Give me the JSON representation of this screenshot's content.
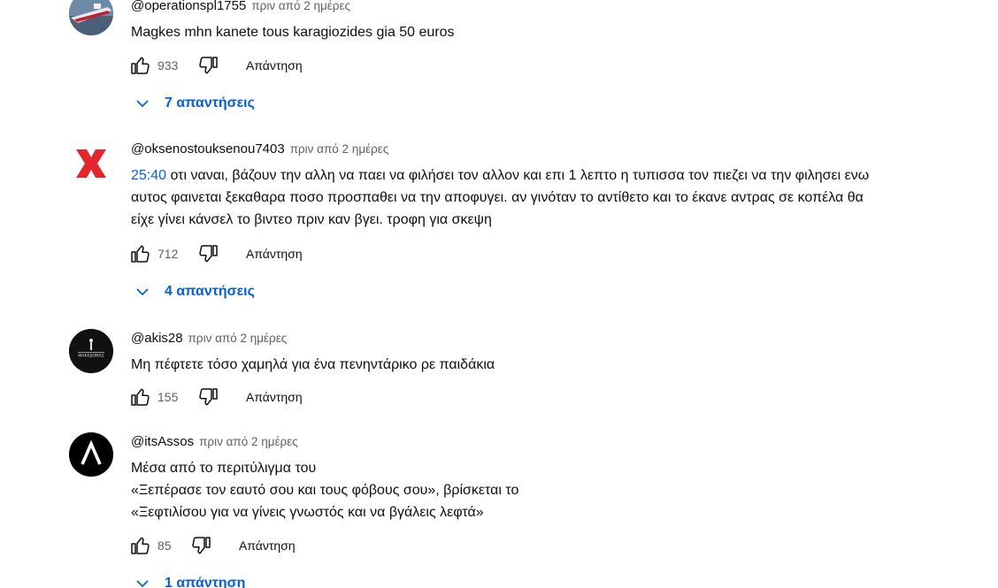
{
  "comments": [
    {
      "author": "@operationspl1755",
      "time": "πριν από 2 ημέρες",
      "timestamp_link": "",
      "lines": [
        "Magkes mhn kanete tous karagiozides gia 50 euros"
      ],
      "likes": "933",
      "reply_label": "Απάντηση",
      "replies_label": "7 απαντήσεις",
      "avatar": "ship-icon"
    },
    {
      "author": "@oksenostouksenou7403",
      "time": "πριν από 2 ημέρες",
      "timestamp_link": "25:40",
      "lines": [
        " οτι ναναι, βάζουν την αλλη να παει να φιλήσει τον αλλον και επι 1 λεπτο η τυπισσα τον πιεζει να την φιλησει ενω",
        "αυτος φαινεται ξεκαθαρα ποσο προσπαθει να την αποφυγει. αν γινόταν το αντίθετο και το έκανε αντρας σε κοπέλα θα",
        "είχε γίνει κάνσελ το βιντεο πριν καν βγει. τροφη για σκεψη"
      ],
      "likes": "712",
      "reply_label": "Απάντηση",
      "replies_label": "4 απαντήσεις",
      "avatar": "red-x-icon"
    },
    {
      "author": "@akis28",
      "time": "πριν από 2 ημέρες",
      "timestamp_link": "",
      "lines": [
        "Μη πέφτετε τόσο χαμηλά για ένα πενηντάρικο ρε παιδάκια"
      ],
      "likes": "155",
      "reply_label": "Απάντηση",
      "replies_label": "",
      "avatar": "makedonas-logo",
      "avatar_text": "ΜΑΚΕΔΟΝΑΣ"
    },
    {
      "author": "@itsAssos",
      "time": "πριν από 2 ημέρες",
      "timestamp_link": "",
      "lines": [
        "Μέσα από το περιτύλιγμα του",
        "«Ξεπέρασε τον εαυτό σου και τους φόβους σου», βρίσκεται το",
        "«Ξεφτιλίσου για να γίνεις γνωστός και να βγάλεις λεφτά»"
      ],
      "likes": "85",
      "reply_label": "Απάντηση",
      "replies_label": "1 απάντηση",
      "avatar": "letter-a-icon"
    }
  ],
  "colors": {
    "link": "#065fd4",
    "secondary_text": "#606060",
    "primary_text": "#0f0f0f",
    "red_x": "#e3262b"
  }
}
